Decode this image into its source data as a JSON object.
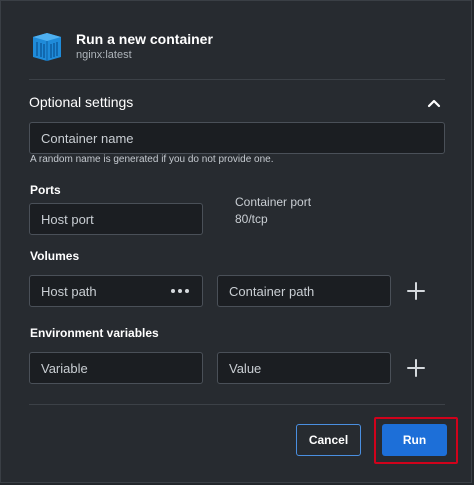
{
  "header": {
    "icon": "docker-container-icon",
    "title": "Run a new container",
    "subtitle": "nginx:latest"
  },
  "optional_settings": {
    "title": "Optional settings",
    "expanded": true,
    "container_name": {
      "placeholder": "Container name",
      "value": "",
      "helper": "A random name is generated if you do not provide one."
    },
    "ports": {
      "label": "Ports",
      "host_port_placeholder": "Host port",
      "container_port_label": "Container port",
      "container_port_value": "80/tcp"
    },
    "volumes": {
      "label": "Volumes",
      "host_path_placeholder": "Host path",
      "container_path_placeholder": "Container path"
    },
    "env": {
      "label": "Environment variables",
      "variable_placeholder": "Variable",
      "value_placeholder": "Value"
    }
  },
  "footer": {
    "cancel_label": "Cancel",
    "run_label": "Run"
  },
  "colors": {
    "background": "#272b30",
    "accent": "#1d6fd8",
    "highlight": "#d0021b"
  }
}
